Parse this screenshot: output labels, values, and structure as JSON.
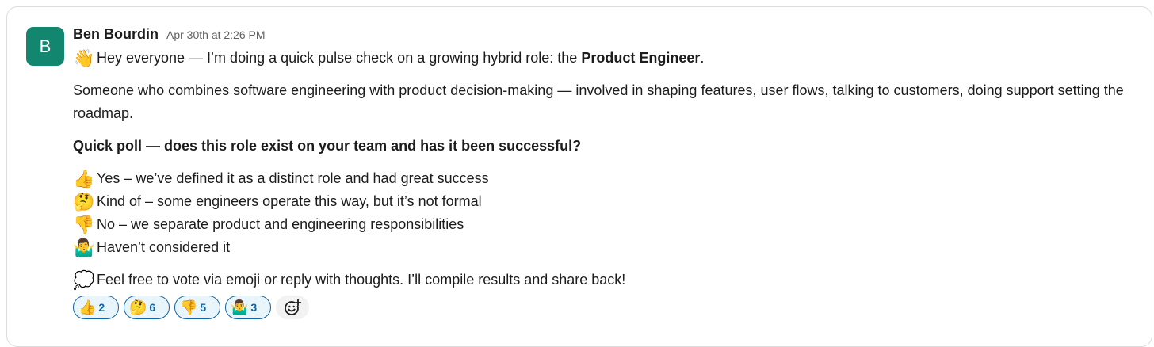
{
  "message": {
    "avatar_letter": "B",
    "avatar_color": "#12866e",
    "author": "Ben Bourdin",
    "timestamp": "Apr 30th at 2:26 PM",
    "intro": {
      "emoji": "👋",
      "text_before": "Hey everyone — I’m doing a quick pulse check on a growing hybrid role: the ",
      "text_bold": "Product Engineer",
      "text_after": "."
    },
    "description": "Someone who combines software engineering with product decision-making — involved in shaping features, user flows, talking to customers, doing support setting the roadmap.",
    "poll_question": "Quick poll — does this role exist on your team and has it been successful?",
    "options": [
      {
        "emoji": "👍",
        "text": "Yes – we’ve defined it as a distinct role and had great success"
      },
      {
        "emoji": "🤔",
        "text": "Kind of – some engineers operate this way, but it’s not formal"
      },
      {
        "emoji": "👎",
        "text": "No – we separate product and engineering responsibilities"
      },
      {
        "emoji": "🤷‍♂️",
        "text": "Haven’t considered it"
      }
    ],
    "closing": {
      "emoji": "💭",
      "text": "Feel free to vote via emoji or reply with thoughts. I’ll compile results and share back!"
    }
  },
  "reactions": [
    {
      "emoji": "👍",
      "count": "2"
    },
    {
      "emoji": "🤔",
      "count": "6"
    },
    {
      "emoji": "👎",
      "count": "5"
    },
    {
      "emoji": "🤷‍♂️",
      "count": "3"
    }
  ],
  "add_reaction_icon": "add-emoji-icon",
  "colors": {
    "reaction_border": "#1264a3",
    "reaction_bg": "#e8f5fa",
    "timestamp": "#616061"
  }
}
